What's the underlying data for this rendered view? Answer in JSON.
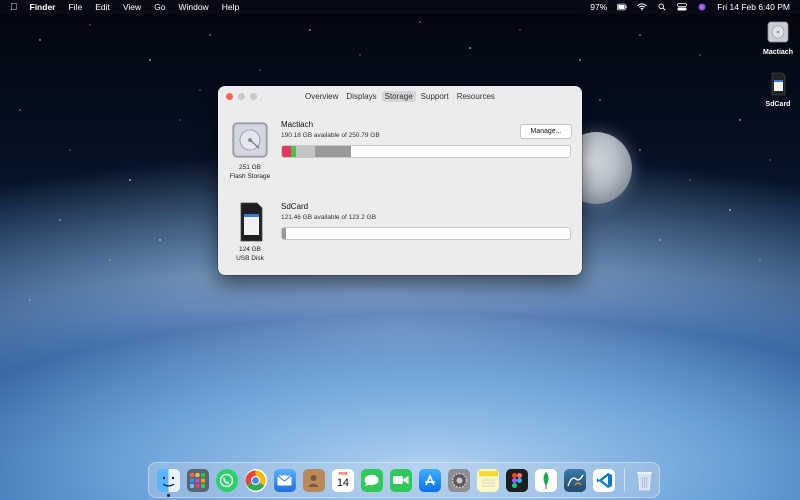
{
  "menubar": {
    "app_name": "Finder",
    "menus": [
      "File",
      "Edit",
      "View",
      "Go",
      "Window",
      "Help"
    ],
    "battery": "97%",
    "datetime": "Fri 14 Feb  6:40 PM"
  },
  "desktop": {
    "icons": [
      {
        "label": "Mactiach"
      },
      {
        "label": "SdCard"
      }
    ]
  },
  "window": {
    "tabs": [
      "Overview",
      "Displays",
      "Storage",
      "Support",
      "Resources"
    ],
    "active_tab": "Storage",
    "drives": [
      {
        "name": "Mactiach",
        "available": "190.18 GB available of 250.79 GB",
        "capacity": "251 GB",
        "type": "Flash Storage",
        "button": "Manage...",
        "segments": [
          {
            "fraction": 0.03,
            "color": "#e8365a"
          },
          {
            "fraction": 0.02,
            "color": "#4cc24a"
          },
          {
            "fraction": 0.065,
            "color": "#c4c4c4"
          },
          {
            "fraction": 0.125,
            "color": "#9a9a9a"
          }
        ]
      },
      {
        "name": "SdCard",
        "available": "121.46 GB available of 123.2 GB",
        "capacity": "124 GB",
        "type": "USB Disk",
        "segments": [
          {
            "fraction": 0.014,
            "color": "#9a9a9a"
          }
        ]
      }
    ]
  },
  "dock": {
    "apps": [
      {
        "name": "finder-icon",
        "color": "#2b8cf0"
      },
      {
        "name": "launchpad-icon",
        "color": "#6b7280"
      },
      {
        "name": "whatsapp-icon",
        "color": "#25d366"
      },
      {
        "name": "chrome-icon",
        "color": "#ffffff"
      },
      {
        "name": "mail-icon",
        "color": "#3b8ff5"
      },
      {
        "name": "contacts-icon",
        "color": "#b68a5a"
      },
      {
        "name": "calendar-icon",
        "color": "#ffffff"
      },
      {
        "name": "messages-icon",
        "color": "#34c759"
      },
      {
        "name": "facetime-icon",
        "color": "#30c85a"
      },
      {
        "name": "app-store-icon",
        "color": "#1e8ef5"
      },
      {
        "name": "system-preferences-icon",
        "color": "#8e8e93"
      },
      {
        "name": "notes-icon",
        "color": "#fff7c2"
      },
      {
        "name": "figma-icon",
        "color": "#1e1e1e"
      },
      {
        "name": "mongodb-icon",
        "color": "#ffffff"
      },
      {
        "name": "mysql-workbench-icon",
        "color": "#2c5f85"
      },
      {
        "name": "vscode-icon",
        "color": "#ffffff"
      }
    ],
    "calendar": {
      "month": "FEB",
      "day": "14"
    }
  }
}
